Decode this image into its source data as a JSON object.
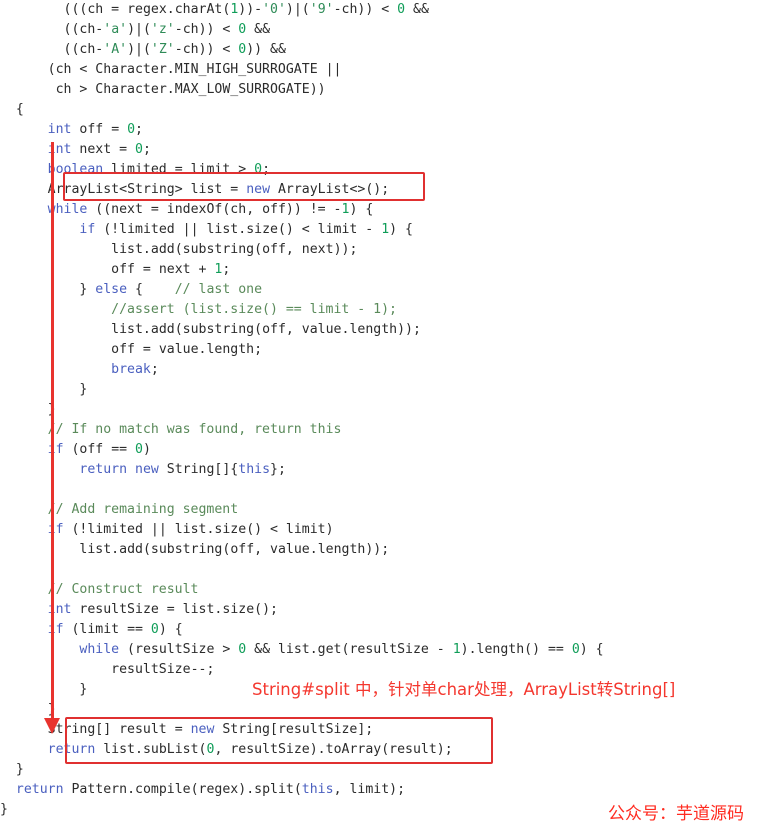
{
  "meta": {
    "language": "Java",
    "accent_color": "#e8332e",
    "keyword_color": "#4a5fbf",
    "number_color": "#0f9d58",
    "string_color": "#2e8b57",
    "comment_color": "#5a8a5a",
    "background_color": "#ffffff"
  },
  "code": {
    "lines": [
      "        (((ch = regex.charAt(1))-'0')|('9'-ch)) < 0 &&",
      "        ((ch-'a')|('z'-ch)) < 0 &&",
      "        ((ch-'A')|('Z'-ch)) < 0)) &&",
      "      (ch < Character.MIN_HIGH_SURROGATE ||",
      "       ch > Character.MAX_LOW_SURROGATE))",
      "  {",
      "      int off = 0;",
      "      int next = 0;",
      "      boolean limited = limit > 0;",
      "      ArrayList<String> list = new ArrayList<>();",
      "      while ((next = indexOf(ch, off)) != -1) {",
      "          if (!limited || list.size() < limit - 1) {",
      "              list.add(substring(off, next));",
      "              off = next + 1;",
      "          } else {    // last one",
      "              //assert (list.size() == limit - 1);",
      "              list.add(substring(off, value.length));",
      "              off = value.length;",
      "              break;",
      "          }",
      "      }",
      "      // If no match was found, return this",
      "      if (off == 0)",
      "          return new String[]{this};",
      "",
      "      // Add remaining segment",
      "      if (!limited || list.size() < limit)",
      "          list.add(substring(off, value.length));",
      "",
      "      // Construct result",
      "      int resultSize = list.size();",
      "      if (limit == 0) {",
      "          while (resultSize > 0 && list.get(resultSize - 1).length() == 0) {",
      "              resultSize--;",
      "          }",
      "      }",
      "      String[] result = new String[resultSize];",
      "      return list.subList(0, resultSize).toArray(result);",
      "  }",
      "  return Pattern.compile(regex).split(this, limit);",
      "}"
    ]
  },
  "annotations": {
    "note_text": "String#split 中，针对单char处理，ArrayList转String[]",
    "watermark_text": "公众号：芋道源码",
    "highlight_boxes": [
      {
        "name": "arraylist-declaration-highlight",
        "target_line": "ArrayList<String> list = new ArrayList<>();"
      },
      {
        "name": "result-conversion-highlight",
        "target_line": "String[] result = new String[resultSize]; / return list.subList(0, resultSize).toArray(result);"
      }
    ],
    "flow_arrow": {
      "name": "flow-arrow",
      "from_line": "ArrayList<String> list = new ArrayList<>();",
      "to_line": "String[] result = new String[resultSize];",
      "direction": "down"
    }
  }
}
